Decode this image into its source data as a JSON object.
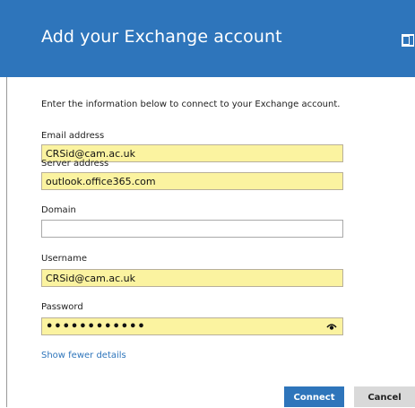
{
  "header": {
    "title": "Add your Exchange account",
    "icon": "exchange-app-icon"
  },
  "intro": "Enter the information below to connect to your Exchange account.",
  "fields": {
    "email": {
      "label": "Email address",
      "value": "CRSid@cam.ac.uk"
    },
    "server": {
      "label": "Server address",
      "value": "outlook.office365.com"
    },
    "domain": {
      "label": "Domain",
      "value": ""
    },
    "username": {
      "label": "Username",
      "value": "CRSid@cam.ac.uk"
    },
    "password": {
      "label": "Password",
      "value": "••••••••••••",
      "reveal_icon": "eye-icon"
    }
  },
  "link": {
    "show_fewer": "Show fewer details"
  },
  "buttons": {
    "connect": "Connect",
    "cancel": "Cancel"
  },
  "colors": {
    "accent": "#2e75bb",
    "field_highlight": "#fbf3a0",
    "cancel_bg": "#d9d9d9"
  }
}
